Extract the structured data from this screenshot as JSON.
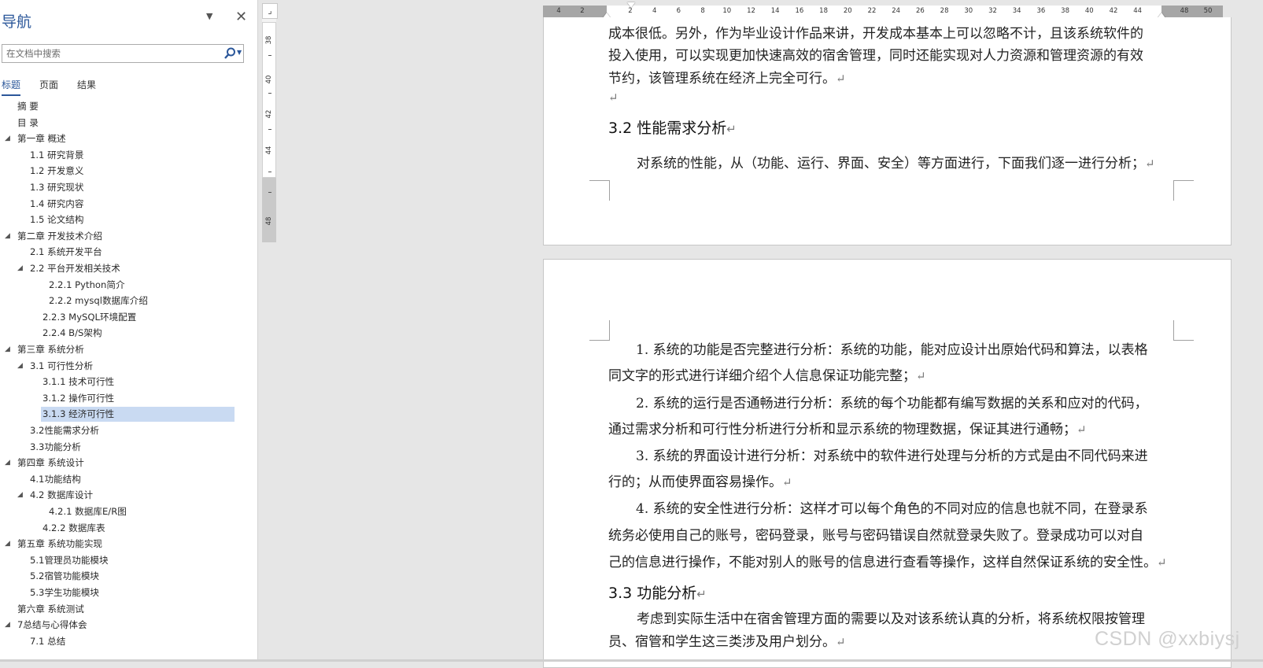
{
  "nav": {
    "title": "导航",
    "search_placeholder": "在文档中搜索",
    "tabs": [
      {
        "label": "标题",
        "active": true
      },
      {
        "label": "页面",
        "active": false
      },
      {
        "label": "结果",
        "active": false
      }
    ],
    "outline": [
      {
        "label": "摘  要",
        "level": 0,
        "toggle": false
      },
      {
        "label": "目  录",
        "level": 0,
        "toggle": false
      },
      {
        "label": "第一章 概述",
        "level": 0,
        "toggle": true
      },
      {
        "label": "1.1 研究背景",
        "level": 1,
        "toggle": false
      },
      {
        "label": "1.2 开发意义",
        "level": 1,
        "toggle": false
      },
      {
        "label": "1.3 研究现状",
        "level": 1,
        "toggle": false
      },
      {
        "label": "1.4 研究内容",
        "level": 1,
        "toggle": false
      },
      {
        "label": "1.5 论文结构",
        "level": 1,
        "toggle": false
      },
      {
        "label": " 第二章 开发技术介绍",
        "level": 0,
        "toggle": true
      },
      {
        "label": "2.1 系统开发平台",
        "level": 1,
        "toggle": false
      },
      {
        "label": "2.2 平台开发相关技术",
        "level": 1,
        "toggle": true
      },
      {
        "label": "2.2.1   Python简介",
        "level": 3,
        "toggle": false
      },
      {
        "label": "2.2.2   mysql数据库介绍",
        "level": 3,
        "toggle": false
      },
      {
        "label": "2.2.3   MySQL环境配置",
        "level": 2,
        "toggle": false
      },
      {
        "label": "2.2.4   B/S架构",
        "level": 2,
        "toggle": false
      },
      {
        "label": "第三章 系统分析",
        "level": 0,
        "toggle": true
      },
      {
        "label": "3.1 可行性分析",
        "level": 1,
        "toggle": true
      },
      {
        "label": "3.1.1 技术可行性",
        "level": 2,
        "toggle": false
      },
      {
        "label": "3.1.2 操作可行性",
        "level": 2,
        "toggle": false
      },
      {
        "label": "3.1.3 经济可行性",
        "level": 2,
        "toggle": false,
        "selected": true
      },
      {
        "label": "3.2性能需求分析",
        "level": 1,
        "toggle": false
      },
      {
        "label": "3.3功能分析",
        "level": 1,
        "toggle": false
      },
      {
        "label": "第四章 系统设计",
        "level": 0,
        "toggle": true
      },
      {
        "label": "4.1功能结构",
        "level": 1,
        "toggle": false
      },
      {
        "label": "4.2 数据库设计",
        "level": 1,
        "toggle": true
      },
      {
        "label": "4.2.1 数据库E/R图",
        "level": 3,
        "toggle": false
      },
      {
        "label": "4.2.2 数据库表",
        "level": 2,
        "toggle": false
      },
      {
        "label": "第五章 系统功能实现",
        "level": 0,
        "toggle": true
      },
      {
        "label": "5.1管理员功能模块",
        "level": 1,
        "toggle": false
      },
      {
        "label": "5.2宿管功能模块",
        "level": 1,
        "toggle": false
      },
      {
        "label": "5.3学生功能模块",
        "level": 1,
        "toggle": false
      },
      {
        "label": "第六章 系统测试",
        "level": 0,
        "toggle": false
      },
      {
        "label": "7总结与心得体会",
        "level": 0,
        "toggle": true
      },
      {
        "label": "7.1 总结",
        "level": 1,
        "toggle": false
      }
    ]
  },
  "ruler": {
    "corner": "⌟",
    "h_left": [
      "4",
      "2"
    ],
    "h_main": [
      "2",
      "4",
      "6",
      "8",
      "10",
      "12",
      "14",
      "16",
      "18",
      "20",
      "22",
      "24",
      "26",
      "28",
      "30",
      "32",
      "34",
      "36",
      "38",
      "40",
      "42",
      "44"
    ],
    "h_right": [
      "48",
      "50"
    ],
    "v_numbers": [
      "38",
      "40",
      "42",
      "44",
      "48"
    ]
  },
  "doc": {
    "p1_lines": [
      "成本很低。另外，作为毕业设计作品来讲，开发成本基本上可以忽略不计，且该系统软件的",
      "投入使用，可以实现更加快速高效的宿舍管理，同时还能实现对人力资源和管理资源的有效",
      "节约，该管理系统在经济上完全可行。"
    ],
    "h32": "3.2 性能需求分析",
    "p2": "对系统的性能，从（功能、运行、界面、安全）等方面进行，下面我们逐一进行分析；",
    "list": [
      "1.  系统的功能是否完整进行分析：系统的功能，能对应设计出原始代码和算法，以表格",
      "同文字的形式进行详细介绍个人信息保证功能完整；",
      "2.  系统的运行是否通畅进行分析：系统的每个功能都有编写数据的关系和应对的代码，",
      "通过需求分析和可行性分析进行分析和显示系统的物理数据，保证其进行通畅；",
      "3.  系统的界面设计进行分析：对系统中的软件进行处理与分析的方式是由不同代码来进",
      "行的；从而使界面容易操作。",
      "4.  系统的安全性进行分析：这样才可以每个角色的不同对应的信息也就不同，在登录系",
      "统务必使用自己的账号，密码登录，账号与密码错误自然就登录失败了。登录成功可以对自",
      "己的信息进行操作，不能对别人的账号的信息进行查看等操作，这样自然保证系统的安全性。"
    ],
    "h33": "3.3 功能分析",
    "p3_lines": [
      "考虑到实际生活中在宿舍管理方面的需要以及对该系统认真的分析，将系统权限按管理",
      "员、宿管和学生这三类涉及用户划分。"
    ],
    "para_mark": "↵"
  },
  "watermark": "CSDN @xxbiysj"
}
